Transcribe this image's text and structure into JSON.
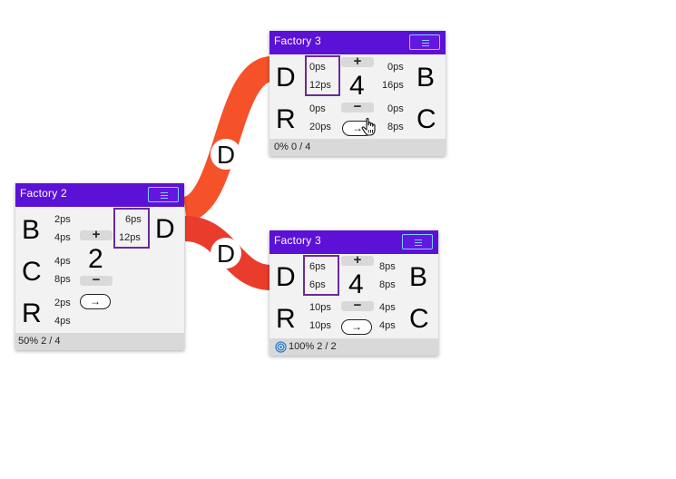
{
  "colors": {
    "header": "#5c11d6",
    "link_a": "#f5522a",
    "link_b": "#ea3c2c",
    "selection_border": "#6a2a9a"
  },
  "links": [
    {
      "label": "D"
    },
    {
      "label": "D"
    }
  ],
  "nodes": {
    "factory2": {
      "title": "Factory 2",
      "inputs": [
        {
          "name": "B",
          "rate1": "2ps",
          "rate2": "4ps"
        },
        {
          "name": "C",
          "rate1": "4ps",
          "rate2": "8ps"
        },
        {
          "name": "R",
          "rate1": "2ps",
          "rate2": "4ps"
        }
      ],
      "outputs": [
        {
          "name": "D",
          "rate1": "6ps",
          "rate2": "12ps"
        }
      ],
      "plus": "+",
      "minus": "−",
      "count": "2",
      "go": "→",
      "status": "50% 2 / 4"
    },
    "factory3_top": {
      "title": "Factory 3",
      "inputs": [
        {
          "name": "D",
          "rate1": "0ps",
          "rate2": "12ps"
        },
        {
          "name": "R",
          "rate1": "0ps",
          "rate2": "20ps"
        }
      ],
      "outputs": [
        {
          "name": "B",
          "rate1": "0ps",
          "rate2": "16ps"
        },
        {
          "name": "C",
          "rate1": "0ps",
          "rate2": "8ps"
        }
      ],
      "plus": "+",
      "minus": "−",
      "count": "4",
      "go": "→",
      "status": "0% 0 / 4"
    },
    "factory3_bottom": {
      "title": "Factory 3",
      "inputs": [
        {
          "name": "D",
          "rate1": "6ps",
          "rate2": "6ps"
        },
        {
          "name": "R",
          "rate1": "10ps",
          "rate2": "10ps"
        }
      ],
      "outputs": [
        {
          "name": "B",
          "rate1": "8ps",
          "rate2": "8ps"
        },
        {
          "name": "C",
          "rate1": "4ps",
          "rate2": "4ps"
        }
      ],
      "plus": "+",
      "minus": "−",
      "count": "4",
      "go": "→",
      "status": "100% 2 / 2"
    }
  }
}
